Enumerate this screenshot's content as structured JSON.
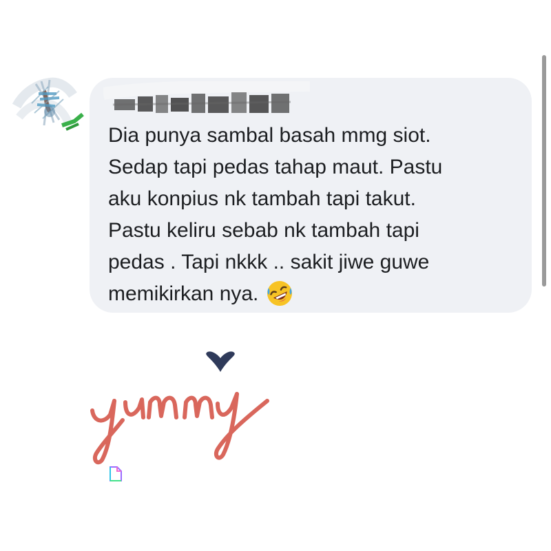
{
  "comment": {
    "author_name": "",
    "lines": [
      "Dia punya sambal basah mmg siot.",
      "Sedap tapi pedas tahap maut. Pastu",
      "aku konpius nk tambah tapi takut.",
      "Pastu keliru sebab nk tambah tapi",
      "pedas . Tapi nkkk .. sakit jiwe guwe",
      "memikirkan nya."
    ],
    "emoji": "rolling-on-floor-laughing-icon"
  },
  "sticker": {
    "text": "yummy",
    "color": "#d9675c",
    "heart_color": "#2f3a5a"
  },
  "colors": {
    "bubble": "#eff1f5",
    "text": "#1c1e21",
    "scrollbar": "#9a9a9a"
  }
}
